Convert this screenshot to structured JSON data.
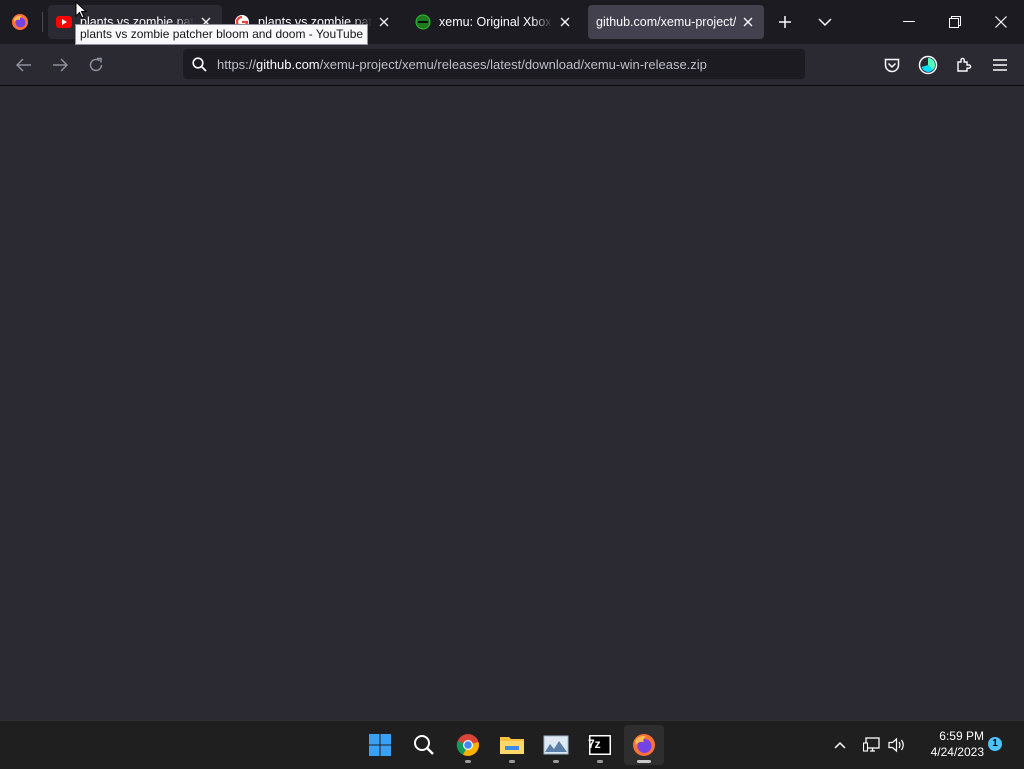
{
  "browser": {
    "tabs": [
      {
        "title": "plants vs zombie patcher bloom and doom - YouTube",
        "favicon": "youtube-icon",
        "state": "hover"
      },
      {
        "title": "plants vs zombie patcher",
        "favicon": "google-icon",
        "state": "normal"
      },
      {
        "title": "xemu: Original Xbox Emulator",
        "favicon": "xemu-icon",
        "state": "normal"
      },
      {
        "title": "github.com/xemu-project/",
        "favicon": "none",
        "state": "active"
      }
    ],
    "tooltip": "plants vs zombie patcher bloom and doom - YouTube",
    "url": {
      "scheme": "https://",
      "host": "github.com",
      "path": "/xemu-project/xemu/releases/latest/download/xemu-win-release.zip"
    }
  },
  "taskbar": {
    "apps": [
      "windows-start-icon",
      "search-icon",
      "chrome-icon",
      "file-explorer-icon",
      "photos-icon",
      "7zip-icon",
      "firefox-icon"
    ],
    "time": "6:59 PM",
    "date": "4/24/2023",
    "notification_count": "1",
    "sevenzip_label": "7z"
  },
  "colors": {
    "content_bg": "#2b2a33",
    "tabstrip_bg": "#1c1b22",
    "accent": "#4cc2ff"
  }
}
